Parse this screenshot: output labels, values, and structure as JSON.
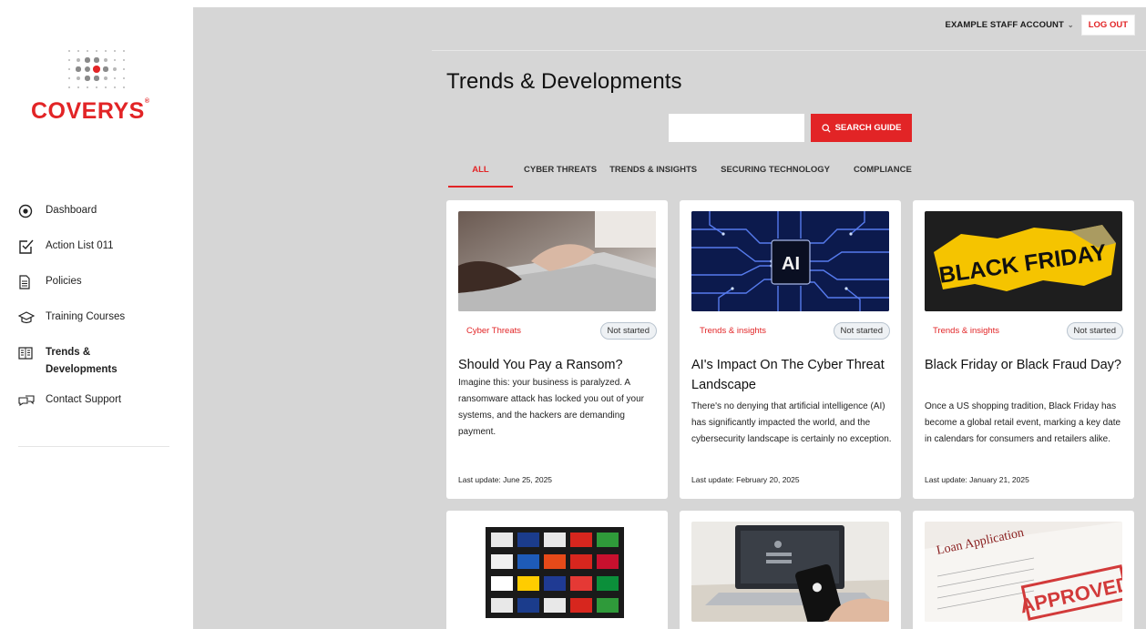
{
  "brand": {
    "name": "COVERYS",
    "mark": "®"
  },
  "nav": {
    "items": [
      {
        "label": "Dashboard",
        "icon": "target-icon"
      },
      {
        "label": "Action List  011",
        "icon": "checkbox-icon"
      },
      {
        "label": "Policies",
        "icon": "document-icon"
      },
      {
        "label": "Training Courses",
        "icon": "graduation-cap-icon"
      },
      {
        "label": "Trends &",
        "label2": "Developments",
        "icon": "newspaper-icon",
        "active": true
      },
      {
        "label": "Contact Support",
        "icon": "chat-icon"
      }
    ]
  },
  "header": {
    "account": "EXAMPLE STAFF ACCOUNT",
    "logout": "LOG OUT"
  },
  "page": {
    "title": "Trends & Developments"
  },
  "search": {
    "placeholder": "",
    "value": "",
    "button": "SEARCH GUIDE"
  },
  "tabs": [
    {
      "label": "ALL",
      "active": true
    },
    {
      "label": "CYBER THREATS"
    },
    {
      "label": "TRENDS & INSIGHTS"
    },
    {
      "label": "SECURING TECHNOLOGY"
    },
    {
      "label": "COMPLIANCE"
    }
  ],
  "cards": [
    {
      "category": "Cyber Threats",
      "status": "Not started",
      "title": "Should You Pay a Ransom?",
      "description": "Imagine this: your business is paralyzed. A ransomware attack has locked you out of your systems, and the hackers are demanding payment.",
      "updated": "Last update: June 25, 2025"
    },
    {
      "category": "Trends & insights",
      "status": "Not started",
      "title": "AI's Impact On The Cyber Threat Landscape",
      "description": "There's no denying that artificial intelligence (AI) has significantly impacted the world, and the cybersecurity landscape is certainly no exception.",
      "updated": "Last update: February 20, 2025",
      "image_text": "AI"
    },
    {
      "category": "Trends & insights",
      "status": "Not started",
      "title": "Black Friday or Black Fraud Day?",
      "description": "Once a US shopping tradition, Black Friday has become a global retail event, marking a key date in calendars for consumers and retailers alike.",
      "updated": "Last update: January 21, 2025",
      "image_text": "BLACK FRIDAY"
    }
  ],
  "lower_cards": [
    {
      "image": "flags-grid"
    },
    {
      "image": "laptop-phone"
    },
    {
      "image": "loan-application",
      "image_text": "Loan Application",
      "stamp": "APPROVED"
    }
  ],
  "colors": {
    "accent": "#e22426",
    "main_bg": "#d6d6d6"
  }
}
